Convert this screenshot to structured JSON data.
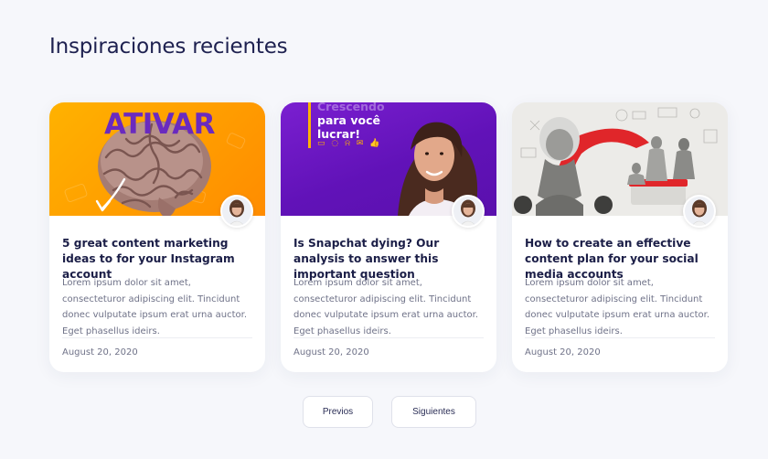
{
  "page": {
    "title": "Inspiraciones recientes"
  },
  "thumb_text": {
    "card1": "ATIVAR",
    "card2_line1": "Crescendo",
    "card2_line2": "para você",
    "card2_line3": "lucrar!"
  },
  "cards": [
    {
      "title": "5 great content marketing ideas to for your Instagram account",
      "excerpt": "Lorem ipsum dolor sit amet, consecteturor adipiscing elit. Tincidunt donec vulputate ipsum erat urna auctor. Eget phasellus ideirs.",
      "date": "August 20, 2020"
    },
    {
      "title": "Is Snapchat dying? Our analysis to answer this important question",
      "excerpt": "Lorem ipsum dolor sit amet, consecteturor adipiscing elit. Tincidunt donec vulputate ipsum erat urna auctor. Eget phasellus ideirs.",
      "date": "August 20, 2020"
    },
    {
      "title": "How to create an effective content plan for your social media accounts",
      "excerpt": "Lorem ipsum dolor sit amet, consecteturor adipiscing elit. Tincidunt donec vulputate ipsum erat urna auctor. Eget phasellus ideirs.",
      "date": "August 20, 2020"
    }
  ],
  "pagination": {
    "prev_label": "Previos",
    "next_label": "Siguientes"
  },
  "colors": {
    "background": "#f6f7fb",
    "title": "#1e2150",
    "card1_accent": "#ffa100",
    "card2_accent": "#6a14c0",
    "card3_accent": "#e0262a"
  }
}
